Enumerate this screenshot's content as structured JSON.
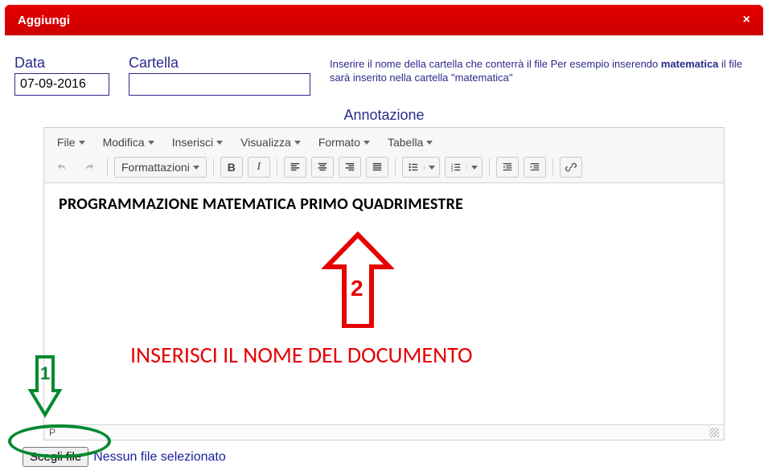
{
  "header": {
    "title": "Aggiungi",
    "close_glyph": "×"
  },
  "fields": {
    "date_label": "Data",
    "date_value": "07-09-2016",
    "folder_label": "Cartella",
    "folder_value": "",
    "hint_pre": "Inserire il nome della cartella che conterrà il file Per esempio inserendo ",
    "hint_bold": "matematica",
    "hint_post": " il file sarà inserito nella cartella \"matematica\"",
    "annot_label": "Annotazione"
  },
  "toolbar": {
    "menus": {
      "file": "File",
      "edit": "Modifica",
      "insert": "Inserisci",
      "view": "Visualizza",
      "format": "Formato",
      "table": "Tabella"
    },
    "format_btn": "Formattazioni"
  },
  "editor": {
    "content": "PROGRAMMAZIONE  MATEMATICA PRIMO QUADRIMESTRE",
    "status_path": "P"
  },
  "file_chooser": {
    "button": "Scegli file",
    "status": "Nessun file selezionato"
  },
  "annotations": {
    "step1": "1",
    "step2": "2",
    "instruction": "INSERISCI IL NOME DEL DOCUMENTO"
  }
}
